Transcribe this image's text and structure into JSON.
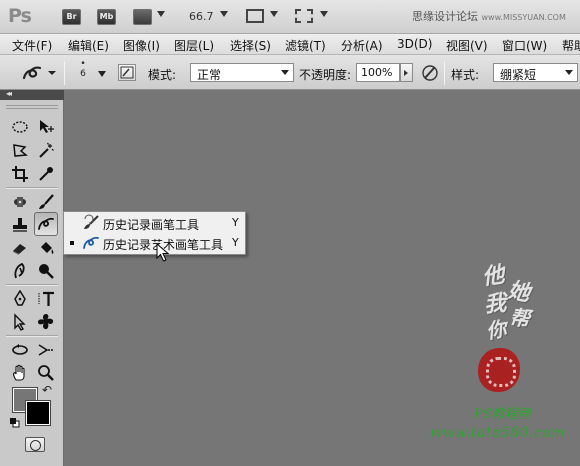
{
  "app": {
    "logo": "Ps",
    "bridge_button": "Br",
    "minibridge_button": "Mb",
    "zoom_level": "66.7",
    "watermark_site": "思缘设计论坛",
    "watermark_url": "www.MISSYUAN.COM"
  },
  "menu": {
    "items": [
      "文件(F)",
      "编辑(E)",
      "图像(I)",
      "图层(L)",
      "选择(S)",
      "滤镜(T)",
      "分析(A)",
      "3D(D)",
      "视图(V)",
      "窗口(W)",
      "帮助"
    ]
  },
  "options": {
    "brush_size": "6",
    "mode_label": "模式:",
    "mode_value": "正常",
    "opacity_label": "不透明度:",
    "opacity_value": "100%",
    "style_label": "样式:",
    "style_value": "绷紧短"
  },
  "flyout": {
    "items": [
      {
        "label": "历史记录画笔工具",
        "shortcut": "Y",
        "selected": false,
        "icon": "history-brush-icon"
      },
      {
        "label": "历史记录艺术画笔工具",
        "shortcut": "Y",
        "selected": true,
        "icon": "art-history-brush-icon"
      }
    ]
  },
  "canvas": {
    "ps_watermark": "PS教程网",
    "url_watermark": "www.tata580.com"
  },
  "colors": {
    "foreground": "#767676",
    "background": "#000000",
    "canvas": "#767676",
    "watermark_green": "#2ca52c",
    "seal_red": "#b01818"
  }
}
